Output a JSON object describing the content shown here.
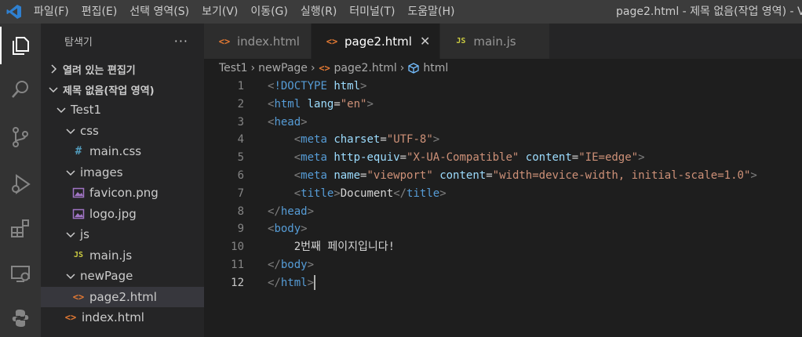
{
  "menu": [
    "파일(F)",
    "편집(E)",
    "선택 영역(S)",
    "보기(V)",
    "이동(G)",
    "실행(R)",
    "터미널(T)",
    "도움말(H)"
  ],
  "window_title": "page2.html - 제목 없음(작업 영역) - V",
  "sidebar": {
    "title": "탐색기",
    "more": "···",
    "open_editors": "열려 있는 편집기",
    "workspace": "제목 없음(작업 영역)",
    "tree": [
      {
        "label": "Test1",
        "type": "folder"
      },
      {
        "label": "css",
        "type": "folder"
      },
      {
        "label": "main.css",
        "type": "css"
      },
      {
        "label": "images",
        "type": "folder"
      },
      {
        "label": "favicon.png",
        "type": "img"
      },
      {
        "label": "logo.jpg",
        "type": "img"
      },
      {
        "label": "js",
        "type": "folder"
      },
      {
        "label": "main.js",
        "type": "js"
      },
      {
        "label": "newPage",
        "type": "folder"
      },
      {
        "label": "page2.html",
        "type": "html"
      },
      {
        "label": "index.html",
        "type": "html"
      }
    ]
  },
  "tabs": [
    {
      "label": "index.html",
      "icon": "html"
    },
    {
      "label": "page2.html",
      "icon": "html",
      "close": "✕"
    },
    {
      "label": "main.js",
      "icon": "js"
    }
  ],
  "breadcrumb": [
    "Test1",
    "newPage",
    "page2.html",
    "html"
  ],
  "code_lines": [
    "1",
    "2",
    "3",
    "4",
    "5",
    "6",
    "7",
    "8",
    "9",
    "10",
    "11",
    "12"
  ],
  "code": {
    "doctype": "!DOCTYPE",
    "doctype_html": "html",
    "lang_attr": "lang",
    "lang_val": "\"en\"",
    "charset_attr": "charset",
    "charset_val": "\"UTF-8\"",
    "httpequiv_attr": "http-equiv",
    "httpequiv_val": "\"X-UA-Compatible\"",
    "content_attr": "content",
    "content_val1": "\"IE=edge\"",
    "name_attr": "name",
    "name_val": "\"viewport\"",
    "content_val2": "\"width=device-width, initial-scale=1.0\"",
    "title_text": "Document",
    "body_text": "2번째 페이지입니다!"
  },
  "colors": {
    "tag": "#569cd6",
    "attr": "#9cdcfe",
    "value": "#ce9178",
    "html_icon": "#e37933",
    "js_icon": "#cbcb41",
    "css_icon": "#519aba"
  }
}
